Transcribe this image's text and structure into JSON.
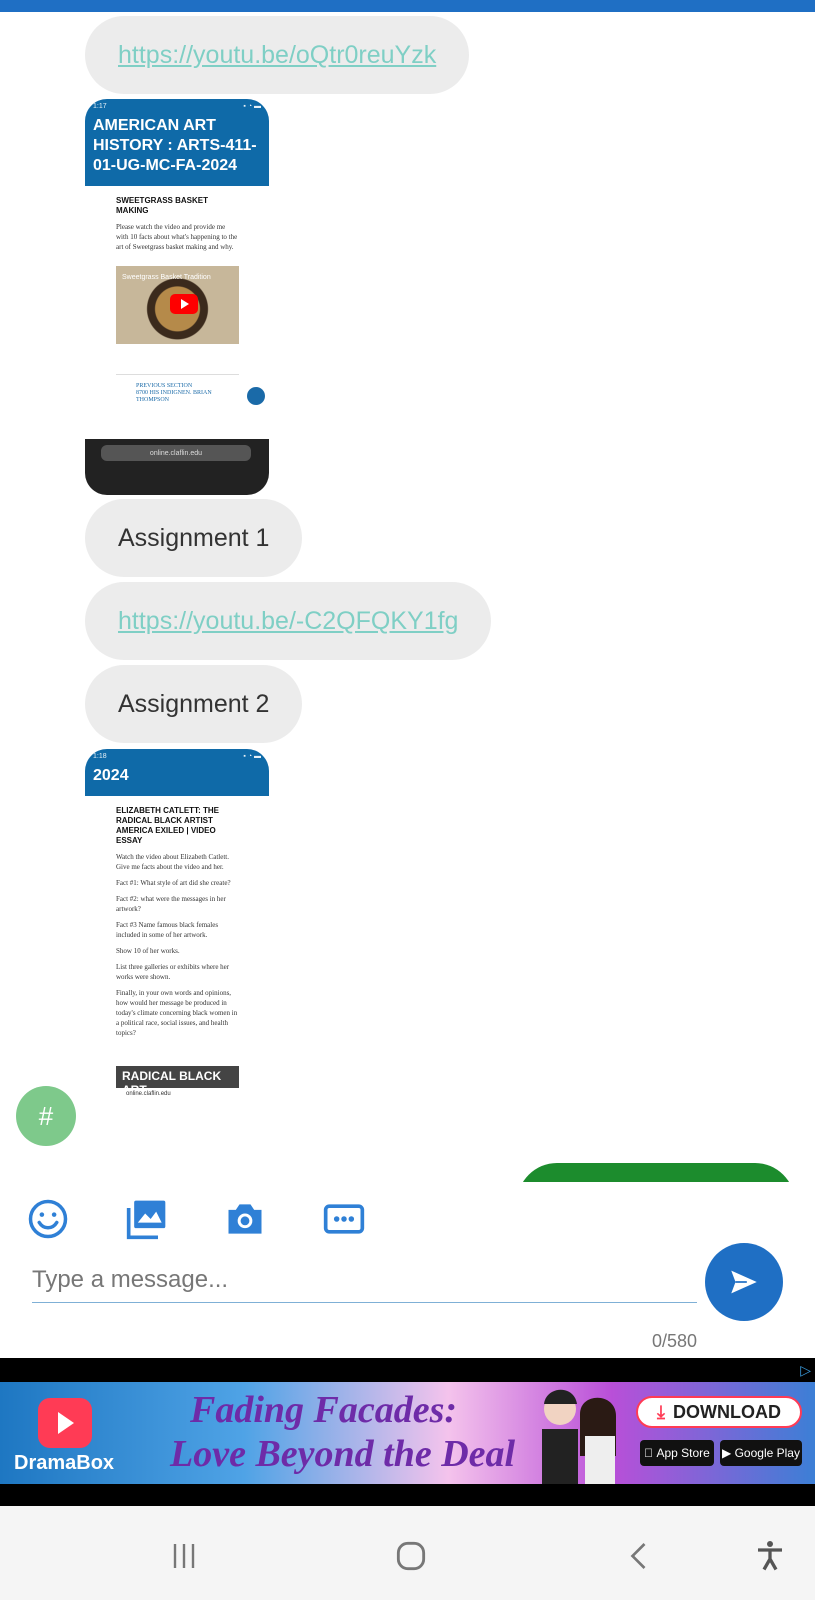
{
  "messages": [
    {
      "type": "link",
      "text": "https://youtu.be/oQtr0reuYzk"
    },
    {
      "type": "text",
      "text": "Assignment 1"
    },
    {
      "type": "link",
      "text": "https://youtu.be/-C2QFQKY1fg"
    },
    {
      "type": "text",
      "text": "Assignment 2"
    }
  ],
  "shot1": {
    "time": "1:17",
    "header": "AMERICAN ART HISTORY : ARTS-411-01-UG-MC-FA-2024",
    "section_title": "SWEETGRASS BASKET MAKING",
    "body": "Please watch the video and provide me with 10 facts about what's happening to the art of Sweetgrass basket making and why.",
    "video_title": "Sweetgrass Basket Tradition",
    "prev_label": "PREVIOUS SECTION",
    "prev_text": "8700 HIS INDIGNEN. BRIAN THOMPSON",
    "url": "online.claflin.edu"
  },
  "shot2": {
    "time": "1:18",
    "header": "2024",
    "section_title": "ELIZABETH CATLETT: THE RADICAL BLACK ARTIST AMERICA EXILED | VIDEO ESSAY",
    "paras": [
      "Watch the video about Elizabeth Catlett. Give me facts about the video and her.",
      "Fact #1: What style of art did she create?",
      "Fact #2: what were the messages in her artwork?",
      "Fact #3 Name famous black females included in some of her artwork.",
      "Show 10 of her works.",
      "List three galleries or exhibits where her works were shown.",
      "Finally, in your own words and opinions, how would her message be produced in today's climate concerning black women in a political race, social issues, and health topics?"
    ],
    "video_title": "RADICAL BLACK ART",
    "url": "online.claflin.edu"
  },
  "hash_button": "#",
  "composer": {
    "placeholder": "Type a message...",
    "counter": "0/580"
  },
  "ad": {
    "brand": "DramaBox",
    "title_line1": "Fading Facades:",
    "title_line2": "Love Beyond the Deal",
    "download": "DOWNLOAD",
    "app_store": "App Store",
    "google_play": "Google Play"
  },
  "colors": {
    "accent": "#1f6fc4",
    "link": "#7fcfc5",
    "bubble": "#ececec",
    "green": "#1c8c2d"
  }
}
